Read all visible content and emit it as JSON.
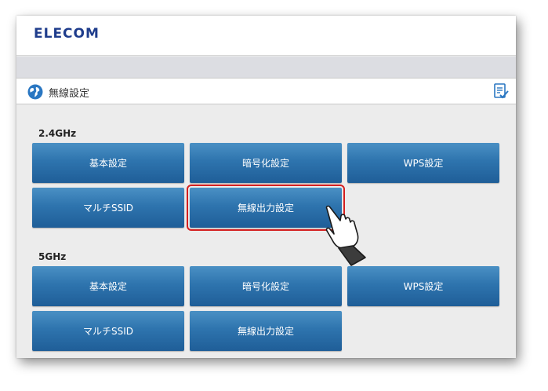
{
  "header": {
    "logo_text": "ELECOM"
  },
  "title_bar": {
    "title": "無線設定",
    "globe_icon": "globe-icon",
    "help_icon": "checklist-icon"
  },
  "sections": [
    {
      "label": "2.4GHz",
      "buttons": [
        "基本設定",
        "暗号化設定",
        "WPS設定",
        "マルチSSID",
        "無線出力設定"
      ]
    },
    {
      "label": "5GHz",
      "buttons": [
        "基本設定",
        "暗号化設定",
        "WPS設定",
        "マルチSSID",
        "無線出力設定"
      ]
    }
  ],
  "highlighted_button": "無線出力設定 (2.4GHz)",
  "colors": {
    "brand": "#1f3d8c",
    "button": "#2e74ae",
    "highlight_border": "#d41f1f",
    "background": "#ececec"
  }
}
